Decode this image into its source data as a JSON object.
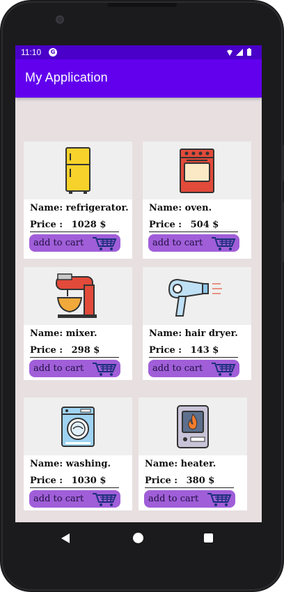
{
  "status_bar": {
    "time": "11:10",
    "notification_icon": "g-icon",
    "icons": [
      "wifi-icon",
      "signal-icon",
      "battery-icon"
    ]
  },
  "app_bar": {
    "title": "My Application"
  },
  "colors": {
    "status_bar": "#4a00c8",
    "app_bar": "#6200ee",
    "background": "#e7dfe0",
    "card_image_bg": "#efefef",
    "cart_button": "#a05ed8"
  },
  "products": [
    {
      "name": "Name: refrigerator.",
      "price_label": "Price :",
      "price": "1028 $",
      "button": "add to cart",
      "icon": "refrigerator-icon"
    },
    {
      "name": "Name: oven.",
      "price_label": "Price :",
      "price": "504 $",
      "button": "add to cart",
      "icon": "oven-icon"
    },
    {
      "name": "Name: mixer.",
      "price_label": "Price :",
      "price": "298 $",
      "button": "add to cart",
      "icon": "mixer-icon"
    },
    {
      "name": "Name: hair dryer.",
      "price_label": "Price :",
      "price": "143 $",
      "button": "add to cart",
      "icon": "hair-dryer-icon"
    },
    {
      "name": "Name: washing.",
      "price_label": "Price :",
      "price": "1030 $",
      "button": "add to cart",
      "icon": "washing-machine-icon"
    },
    {
      "name": "Name: heater.",
      "price_label": "Price :",
      "price": "380 $",
      "button": "add to cart",
      "icon": "heater-icon"
    }
  ],
  "navigation": {
    "icons": [
      "back-icon",
      "home-icon",
      "recents-icon"
    ]
  }
}
